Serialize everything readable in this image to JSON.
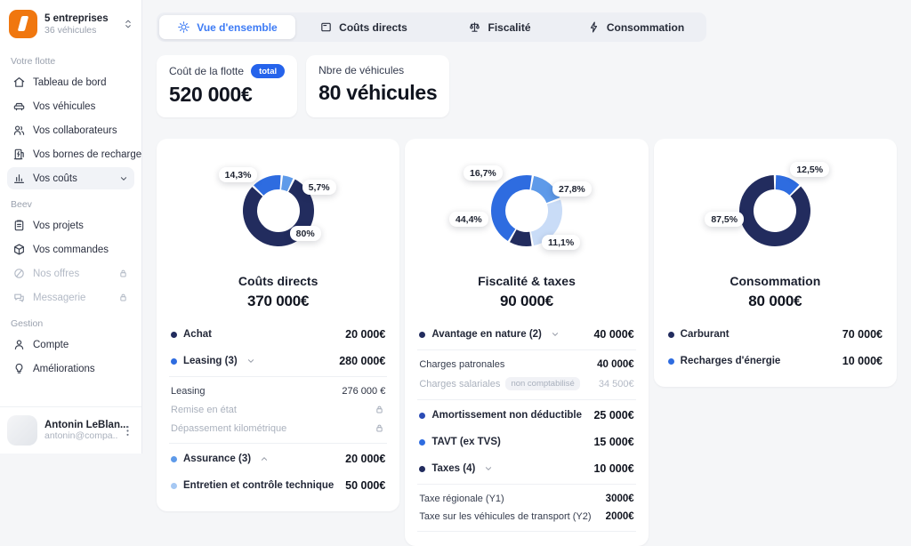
{
  "colors": {
    "navy": "#222c5e",
    "blue": "#2e6ce0",
    "sky": "#5e9ae9",
    "pale": "#a5c8f3",
    "faint": "#c9dcf7",
    "darkblue": "#2a4bb5",
    "accent": "#3d7bf5",
    "badge_blue": "#2563eb",
    "brand_orange": "#f0770f"
  },
  "sidebar": {
    "org": {
      "name": "5 entreprises",
      "subtitle": "36 véhicules"
    },
    "sections": [
      {
        "label": "Votre flotte",
        "items": [
          {
            "label": "Tableau de bord",
            "icon": "home-icon"
          },
          {
            "label": "Vos véhicules",
            "icon": "car-icon"
          },
          {
            "label": "Vos collaborateurs",
            "icon": "users-icon"
          },
          {
            "label": "Vos bornes de recharge",
            "icon": "charger-icon"
          },
          {
            "label": "Vos coûts",
            "icon": "costs-icon",
            "active": true,
            "chevron": true
          }
        ]
      },
      {
        "label": "Beev",
        "items": [
          {
            "label": "Vos projets",
            "icon": "projects-icon"
          },
          {
            "label": "Vos commandes",
            "icon": "orders-icon"
          },
          {
            "label": "Nos offres",
            "icon": "offers-icon",
            "locked": true
          },
          {
            "label": "Messagerie",
            "icon": "messages-icon",
            "locked": true
          }
        ]
      },
      {
        "label": "Gestion",
        "items": [
          {
            "label": "Compte",
            "icon": "account-icon"
          },
          {
            "label": "Améliorations",
            "icon": "improvements-icon"
          }
        ]
      }
    ],
    "user": {
      "name": "Antonin LeBlan...",
      "email": "antonin@compa.."
    }
  },
  "tabs": [
    {
      "label": "Vue d'ensemble",
      "icon": "sun-icon",
      "active": true
    },
    {
      "label": "Coûts directs",
      "icon": "card-icon"
    },
    {
      "label": "Fiscalité",
      "icon": "scale-icon"
    },
    {
      "label": "Consommation",
      "icon": "bolt-icon"
    }
  ],
  "kpis": [
    {
      "label": "Coût de la flotte",
      "badge": "total",
      "value": "520 000€"
    },
    {
      "label": "Nbre de véhicules",
      "value": "80 véhicules"
    }
  ],
  "chart_data": [
    {
      "type": "donut",
      "title": "Coûts directs",
      "total": "370 000€",
      "slices": [
        {
          "label": "14,3%",
          "pct": 14.3,
          "color": "blue"
        },
        {
          "label": "5,7%",
          "pct": 5.7,
          "color": "sky"
        },
        {
          "label": "80%",
          "pct": 80,
          "color": "navy"
        }
      ]
    },
    {
      "type": "donut",
      "title": "Fiscalité & taxes",
      "total": "90 000€",
      "slices": [
        {
          "label": "16,7%",
          "pct": 16.7,
          "color": "sky"
        },
        {
          "label": "27,8%",
          "pct": 27.8,
          "color": "faint"
        },
        {
          "label": "11,1%",
          "pct": 11.1,
          "color": "navy"
        },
        {
          "label": "44,4%",
          "pct": 44.4,
          "color": "blue"
        }
      ]
    },
    {
      "type": "donut",
      "title": "Consommation",
      "total": "80 000€",
      "slices": [
        {
          "label": "12,5%",
          "pct": 12.5,
          "color": "blue"
        },
        {
          "label": "87,5%",
          "pct": 87.5,
          "color": "navy"
        }
      ]
    }
  ],
  "cards": [
    {
      "rows": [
        {
          "type": "item",
          "bullet": "navy",
          "label": "Achat",
          "value": "20 000€"
        },
        {
          "type": "item",
          "bullet": "blue",
          "label": "Leasing (3)",
          "chevron": "down",
          "value": "280 000€"
        },
        {
          "type": "group",
          "items": [
            {
              "label": "Leasing",
              "value": "276 000 €"
            },
            {
              "label": "Remise en état",
              "muted": true,
              "lock": true
            },
            {
              "label": "Dépassement kilométrique",
              "muted": true,
              "lock": true
            }
          ]
        },
        {
          "type": "item",
          "bullet": "sky",
          "label": "Assurance (3)",
          "chevron": "up",
          "value": "20 000€"
        },
        {
          "type": "item",
          "bullet": "pale",
          "label": "Entretien et contrôle technique",
          "value": "50 000€"
        }
      ]
    },
    {
      "rows": [
        {
          "type": "item",
          "bullet": "navy",
          "label": "Avantage en nature (2)",
          "chevron": "down",
          "value": "40 000€"
        },
        {
          "type": "group",
          "items": [
            {
              "label": "Charges patronales",
              "value": "40 000€",
              "boldValue": true
            },
            {
              "label": "Charges salariales",
              "badge": "non comptabilisé",
              "muted": true,
              "value": "34 500€",
              "mutedValue": true
            }
          ]
        },
        {
          "type": "item",
          "bullet": "darkblue",
          "label": "Amortissement non déductible",
          "value": "25 000€"
        },
        {
          "type": "item",
          "bullet": "blue",
          "label": "TAVT (ex TVS)",
          "value": "15 000€"
        },
        {
          "type": "item",
          "bullet": "navy",
          "label": "Taxes (4)",
          "chevron": "down",
          "value": "10 000€"
        },
        {
          "type": "group",
          "items": [
            {
              "label": "Taxe régionale (Y1)",
              "value": "3000€",
              "boldValue": true
            },
            {
              "label": "Taxe sur les véhicules de transport (Y2)",
              "value": "2000€",
              "boldValue": true
            }
          ]
        }
      ]
    },
    {
      "rows": [
        {
          "type": "item",
          "bullet": "navy",
          "label": "Carburant",
          "value": "70 000€"
        },
        {
          "type": "item",
          "bullet": "blue",
          "label": "Recharges d'énergie",
          "value": "10 000€"
        }
      ]
    }
  ]
}
